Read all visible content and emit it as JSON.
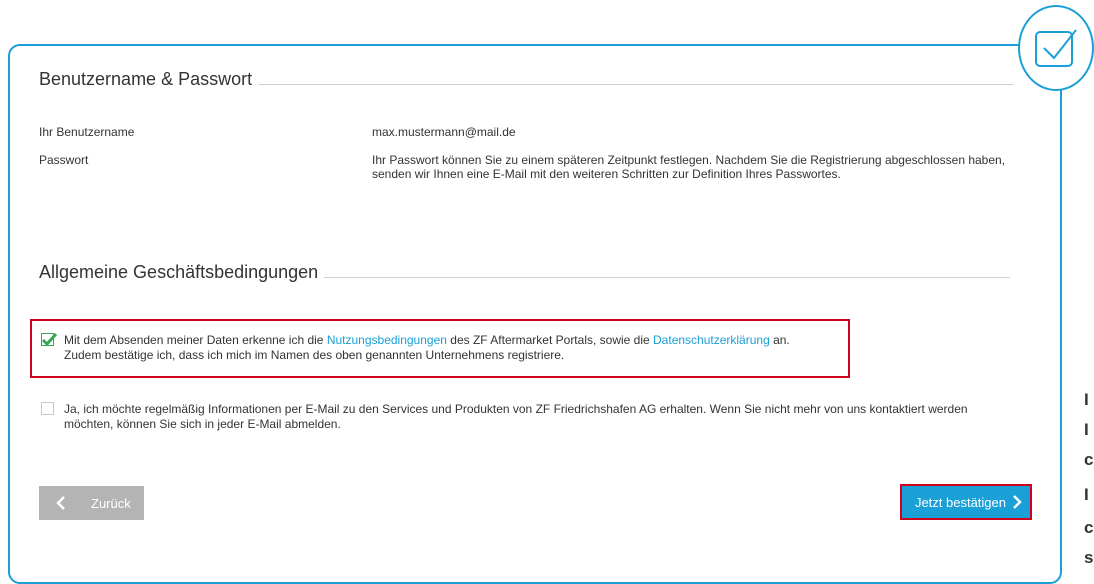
{
  "section_credentials": {
    "title": "Benutzername & Passwort",
    "username_label": "Ihr Benutzername",
    "username_value": "max.mustermann@mail.de",
    "password_label": "Passwort",
    "password_text": "Ihr Passwort können Sie zu einem späteren Zeitpunkt festlegen. Nachdem Sie die Registrierung abgeschlossen haben, senden wir Ihnen eine E-Mail mit den weiteren Schritten zur Definition Ihres Passwortes."
  },
  "section_terms": {
    "title": "Allgemeine Geschäftsbedingungen",
    "terms_checked": true,
    "terms_text_1": "Mit dem Absenden meiner Daten erkenne ich die ",
    "terms_link_1": "Nutzungsbedingungen",
    "terms_text_2": " des ZF Aftermarket Portals, sowie die ",
    "terms_link_2": "Datenschutzerklärung",
    "terms_text_3": " an.",
    "terms_text_4": "Zudem bestätige ich, dass ich mich im Namen des oben genannten Unternehmens registriere.",
    "newsletter_checked": false,
    "newsletter_text": "Ja, ich möchte regelmäßig Informationen per E-Mail zu den Services und Produkten von ZF Friedrichshafen AG erhalten. Wenn Sie nicht mehr von uns kontaktiert werden möchten, können Sie sich in jeder E-Mail abmelden."
  },
  "buttons": {
    "back_label": "Zurück",
    "confirm_label": "Jetzt bestätigen"
  },
  "side_fragments": [
    "I",
    "I",
    "c",
    "I",
    "c",
    "s"
  ],
  "colors": {
    "accent": "#1a9fd6",
    "highlight": "#d0021b",
    "checkbox_checked": "#3aa655",
    "back_button": "#b4b4b4"
  },
  "icons": {
    "step_done": "checkbox-check-icon",
    "back": "chevron-left-icon",
    "forward": "chevron-right-icon"
  }
}
